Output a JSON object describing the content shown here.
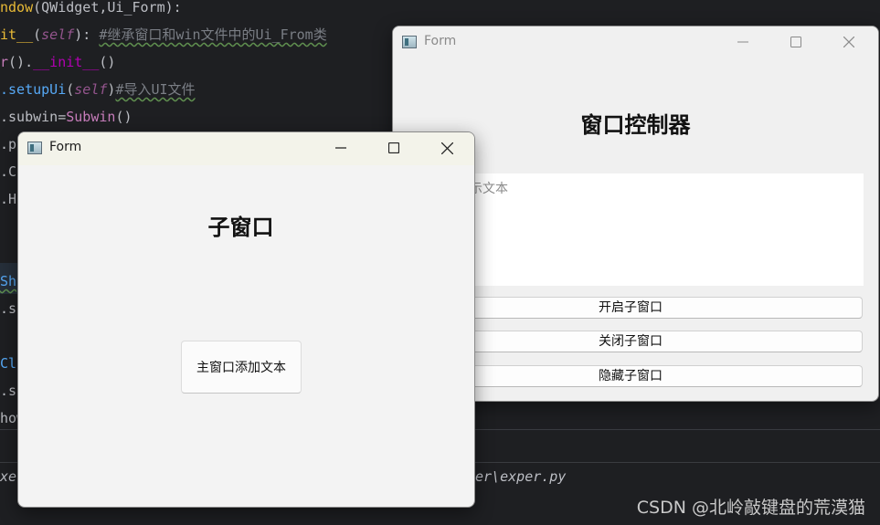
{
  "editor": {
    "lines": [
      {
        "t1": "ndow",
        "t2": "(QWidget,Ui_Form):"
      },
      {
        "t1": "it__",
        "t2": "(",
        "t3": "self",
        "t4": "): ",
        "t5": "#继承窗口和win文件中的Ui_From类"
      },
      {
        "t1": "r",
        "t2": "().",
        "t3": "__init__",
        "t4": "()"
      },
      {
        "t1": ".setupUi",
        "t2": "(",
        "t3": "self",
        "t4": ")",
        "t5": "#导入UI文件"
      },
      {
        "t1": ".subwin",
        "t2": "=",
        "t3": "Subwin",
        "t4": "()"
      },
      {
        "t1": ".p"
      },
      {
        "t1": ".C"
      },
      {
        "t1": ".H"
      },
      {
        "t1": "Sh"
      },
      {
        "t1": ".s"
      },
      {
        "t1": "Cl"
      },
      {
        "t1": ".s"
      },
      {
        "t1": "how"
      }
    ],
    "terminal_left": "xe",
    "terminal_right": "per\\exper.py"
  },
  "watermark": "CSDN @北岭敲键盘的荒漠猫",
  "main_window": {
    "title": "Form",
    "heading": "窗口控制器",
    "textbox_placeholder": "示文本",
    "buttons": [
      "开启子窗口",
      "关闭子窗口",
      "隐藏子窗口"
    ]
  },
  "child_window": {
    "title": "Form",
    "heading": "子窗口",
    "button": "主窗口添加文本"
  },
  "colors": {
    "editor_bg": "#1e1f22",
    "window_bg": "#f3f3f3",
    "function_color": "#56a8f5",
    "comment_color": "#7a7e85"
  },
  "icons": {
    "window_icon": "app-window-icon",
    "minimize": "minimize-icon",
    "maximize": "maximize-icon",
    "close": "close-icon"
  }
}
